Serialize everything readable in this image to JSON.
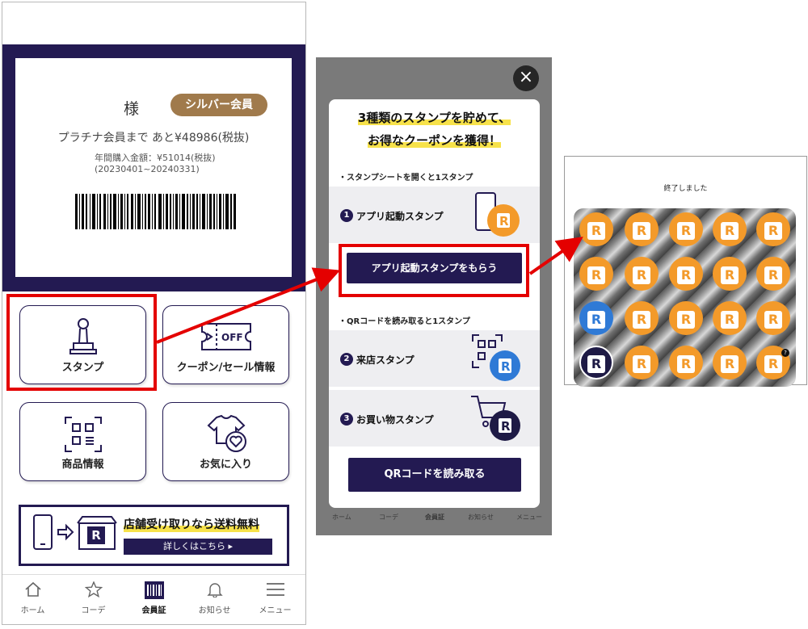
{
  "phone1": {
    "card": {
      "name_suffix": "様",
      "rank_badge": "シルバー会員",
      "until_platinum": "プラチナ会員まで  あと¥48986(税抜)",
      "annual_amount": "年間購入金額：¥51014(税抜)",
      "period": "(20230401~20240331)"
    },
    "tiles": [
      {
        "label": "スタンプ",
        "icon": "stamp-icon"
      },
      {
        "label": "クーポン/セール情報",
        "icon": "coupon-icon"
      },
      {
        "label": "商品情報",
        "icon": "qr-scan-icon"
      },
      {
        "label": "お気に入り",
        "icon": "heart-shirt-icon"
      }
    ],
    "banner": {
      "title": "店舗受け取りなら送料無料",
      "button": "詳しくはこちら ▸",
      "icon_letter": "R"
    },
    "tabs": [
      {
        "label": "ホーム",
        "icon": "home-icon"
      },
      {
        "label": "コーデ",
        "icon": "star-icon"
      },
      {
        "label": "会員証",
        "icon": "barcode-icon",
        "active": true
      },
      {
        "label": "お知らせ",
        "icon": "bell-icon"
      },
      {
        "label": "メニュー",
        "icon": "menu-icon"
      }
    ]
  },
  "phone2": {
    "close": "×",
    "title_line1": "3種類のスタンプを貯めて、",
    "title_line2": "お得なクーポンを獲得！",
    "section1": "・スタンプシートを開くと1スタンプ",
    "row1": {
      "num": "1",
      "label": "アプリ起動スタンプ"
    },
    "app_button": "アプリ起動スタンプをもらう",
    "section2": "・QRコードを読み取ると1スタンプ",
    "row2": {
      "num": "2",
      "label": "来店スタンプ"
    },
    "row3": {
      "num": "3",
      "label": "お買い物スタンプ"
    },
    "qr_button": "QRコードを読み取る",
    "under_tabs": [
      "ホーム",
      "コーデ",
      "会員証",
      "お知らせ",
      "メニュー"
    ],
    "coin_letter": "R"
  },
  "panel3": {
    "ended": "終了しました",
    "coin_letter": "R",
    "help": "?",
    "grid": [
      [
        "orange",
        "orange",
        "orange",
        "orange",
        "orange"
      ],
      [
        "orange",
        "orange",
        "orange",
        "orange",
        "orange"
      ],
      [
        "blue",
        "orange",
        "orange",
        "orange",
        "orange"
      ],
      [
        "navy",
        "orange",
        "orange",
        "orange",
        "orange"
      ]
    ]
  },
  "colors": {
    "navy": "#231a52",
    "highlight_red": "#e40000",
    "badge_gold": "#a07a4c",
    "coin_orange": "#f39a2a",
    "coin_blue": "#2f7ad6",
    "marker_yellow": "#f7e24a"
  }
}
